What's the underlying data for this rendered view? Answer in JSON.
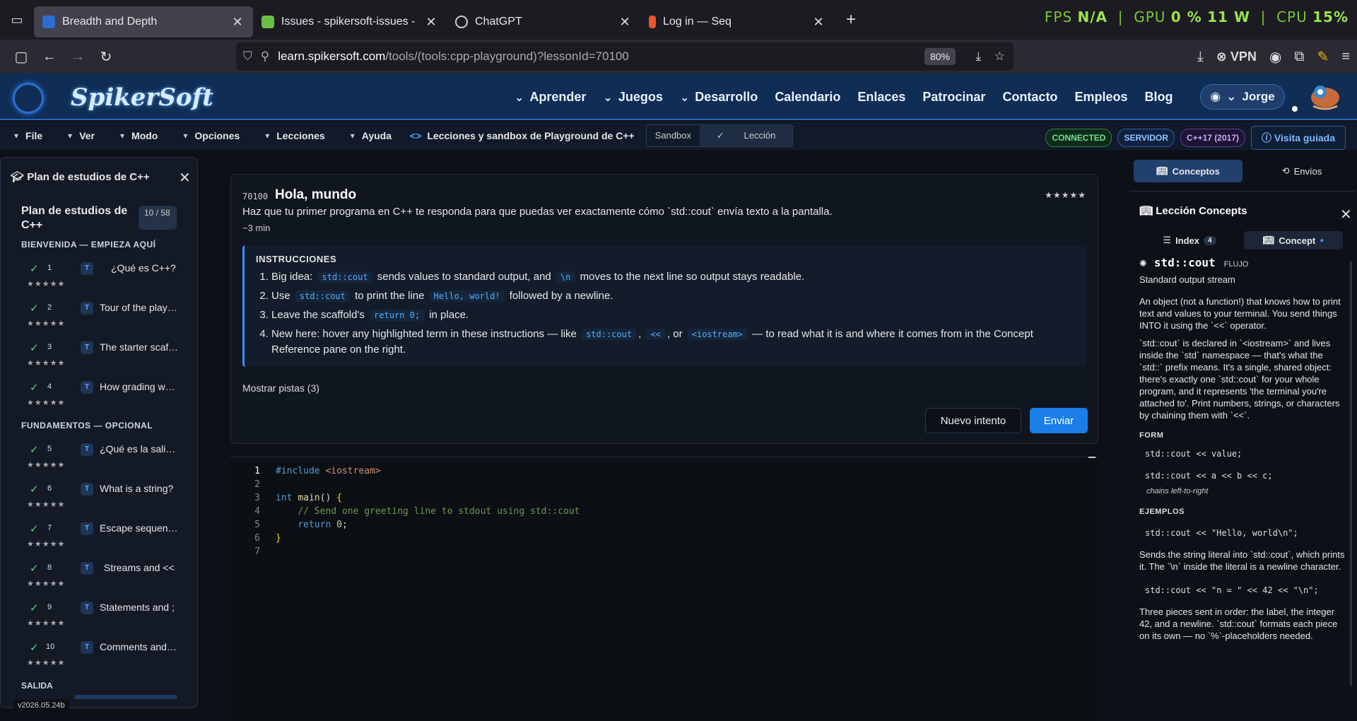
{
  "browser": {
    "tabs": [
      {
        "title": "Breadth and Depth",
        "active": true,
        "favicon_color": "#2c6fd1"
      },
      {
        "title": "Issues - spikersoft-issues - Gitea",
        "active": false,
        "favicon_color": "#6cbf46"
      },
      {
        "title": "ChatGPT",
        "active": false,
        "favicon_color": "#cccccc"
      },
      {
        "title": "Log in — Seq",
        "active": false,
        "favicon_color": "#e8542d"
      }
    ],
    "perf_overlay": {
      "fps_label": "FPS",
      "fps_value": "N/A",
      "gpu_label": "GPU",
      "gpu_value": "0 %",
      "gpu_power": "11 W",
      "cpu_label": "CPU",
      "cpu_value": "15%"
    },
    "url_host": "learn.spikersoft.com",
    "url_path": "/tools/(tools:cpp-playground)?lessonId=70100",
    "zoom": "80%",
    "vpn_label": "VPN"
  },
  "site": {
    "logo": "SpikerSoft",
    "nav": [
      {
        "label": "Aprender",
        "dropdown": true
      },
      {
        "label": "Juegos",
        "dropdown": true
      },
      {
        "label": "Desarrollo",
        "dropdown": true
      },
      {
        "label": "Calendario",
        "dropdown": false
      },
      {
        "label": "Enlaces",
        "dropdown": false
      },
      {
        "label": "Patrocinar",
        "dropdown": false
      },
      {
        "label": "Contacto",
        "dropdown": false
      },
      {
        "label": "Empleos",
        "dropdown": false
      },
      {
        "label": "Blog",
        "dropdown": false
      }
    ],
    "user": "Jorge"
  },
  "toolbar": {
    "menus": [
      "File",
      "Ver",
      "Modo",
      "Opciones",
      "Lecciones",
      "Ayuda"
    ],
    "lesson_title": "Lecciones y sandbox de Playground de C++",
    "mode_sandbox": "Sandbox",
    "mode_lesson": "Lección",
    "status_connected": "CONNECTED",
    "status_server": "SERVIDOR",
    "status_std": "C++17 (2017)",
    "tour_label": "Visita guiada"
  },
  "sidebar": {
    "header": "Plan de estudios de C++",
    "card_title": "Plan de estudios de C++",
    "progress": "10 / 58",
    "sections": [
      {
        "title": "BIENVENIDA — EMPIEZA AQUÍ",
        "lessons": [
          {
            "num": "1",
            "type": "T",
            "name": "¿Qué es C++?",
            "stars": "★★★★★"
          },
          {
            "num": "2",
            "type": "T",
            "name": "Tour of the playground",
            "stars": "★★★★★"
          },
          {
            "num": "3",
            "type": "T",
            "name": "The starter scaffold",
            "stars": "★★★★★"
          },
          {
            "num": "4",
            "type": "T",
            "name": "How grading works",
            "stars": "★★★★★"
          }
        ]
      },
      {
        "title": "FUNDAMENTOS — OPCIONAL",
        "lessons": [
          {
            "num": "5",
            "type": "T",
            "name": "¿Qué es la salida?",
            "stars": "★★★★★"
          },
          {
            "num": "6",
            "type": "T",
            "name": "What is a string?",
            "stars": "★★★★★"
          },
          {
            "num": "7",
            "type": "T",
            "name": "Escape sequences",
            "stars": "★★★★★"
          },
          {
            "num": "8",
            "type": "T",
            "name": "Streams and <<",
            "stars": "★★★★★"
          },
          {
            "num": "9",
            "type": "T",
            "name": "Statements and ;",
            "stars": "★★★★★"
          },
          {
            "num": "10",
            "type": "T",
            "name": "Comments and notes",
            "stars": "★★★★★"
          }
        ]
      }
    ],
    "output_label": "SALIDA",
    "version": "v2026.05.24b"
  },
  "lesson": {
    "id": "70100",
    "title": "Hola, mundo",
    "stars": "★★★★★",
    "description": "Haz que tu primer programa en C++ te responda para que puedas ver exactamente cómo `std::cout` envía texto a la pantalla.",
    "time": "~3 min",
    "instructions_title": "INSTRUCCIONES",
    "instructions": [
      {
        "a": "Big idea:",
        "c1": "std::cout",
        "b": "sends values to standard output, and",
        "c2": "\\n",
        "c": "moves to the next line so output stays readable."
      },
      {
        "a": "Use",
        "c1": "std::cout",
        "b": "to print the line",
        "c2": "Hello, world!",
        "c": "followed by a newline."
      },
      {
        "a": "Leave the scaffold's",
        "c1": "return 0;",
        "b": "in place.",
        "c2": "",
        "c": ""
      },
      {
        "a": "New here: hover any highlighted term in these instructions — like",
        "c1": "std::cout",
        "b": ",",
        "c2": "<<",
        "c": ", or",
        "c3": "<iostream>",
        "d": "— to read what it is and where it comes from in the Concept Reference pane on the right."
      }
    ],
    "hints": "Mostrar pistas (3)",
    "retry_label": "Nuevo intento",
    "send_label": "Enviar"
  },
  "editor": {
    "lines": [
      "1",
      "2",
      "3",
      "4",
      "5",
      "6",
      "7"
    ],
    "code": {
      "l1_pp": "#include",
      "l1_hdr": "<iostream>",
      "l3_kw": "int",
      "l3_fn": "main",
      "l3_rest": "() ",
      "l3_br": "{",
      "l4_cm": "// Send one greeting line to stdout using std::cout",
      "l5_kw": "return",
      "l5_num": "0",
      "l5_end": ";",
      "l6_br": "}"
    }
  },
  "concepts": {
    "tab_concepts": "Conceptos",
    "tab_submissions": "Envíos",
    "panel_title": "Lección Concepts",
    "index_label": "Index",
    "index_count": "4",
    "concept_label": "Concept",
    "term": "std::cout",
    "kind": "FLUJO",
    "subtitle": "Standard output stream",
    "p1": "An object (not a function!) that knows how to print text and values to your terminal. You send things INTO it using the `<<` operator.",
    "p2": "`std::cout` is declared in `<iostream>` and lives inside the `std` namespace — that's what the `std::` prefix means. It's a single, shared object: there's exactly one `std::cout` for your whole program, and it represents 'the terminal you're attached to'. Print numbers, strings, or characters by chaining them with `<<`.",
    "form_title": "FORM",
    "form1": "std::cout << value;",
    "form2": "std::cout << a << b << c;",
    "form_note": "chains left-to-right",
    "examples_title": "EJEMPLOS",
    "ex1": "std::cout << \"Hello, world\\n\";",
    "ex1_desc": "Sends the string literal into `std::cout`, which prints it. The `\\n` inside the literal is a newline character.",
    "ex2": "std::cout << \"n = \" << 42 << \"\\n\";",
    "ex2_desc": "Three pieces sent in order: the label, the integer 42, and a newline. `std::cout` formats each piece on its own — no `%`-placeholders needed."
  }
}
